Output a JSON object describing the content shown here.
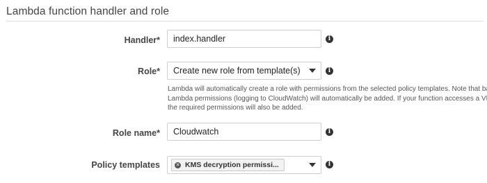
{
  "section": {
    "title": "Lambda function handler and role"
  },
  "handler": {
    "label": "Handler*",
    "value": "index.handler",
    "icon": "info-icon"
  },
  "role": {
    "label": "Role*",
    "selected": "Create new role from template(s)",
    "icon": "info-icon",
    "help": [
      "Lambda will automatically create a role with permissions from the selected policy templates. Note that basic",
      "Lambda permissions (logging to CloudWatch) will automatically be added. If your function accesses a VPC,",
      "the required permissions will also be added."
    ]
  },
  "role_name": {
    "label": "Role name*",
    "value": "Cloudwatch",
    "icon": "info-icon"
  },
  "policy_templates": {
    "label": "Policy templates",
    "tokens": [
      {
        "label": "KMS decryption permissi..."
      }
    ],
    "icon": "info-icon"
  }
}
